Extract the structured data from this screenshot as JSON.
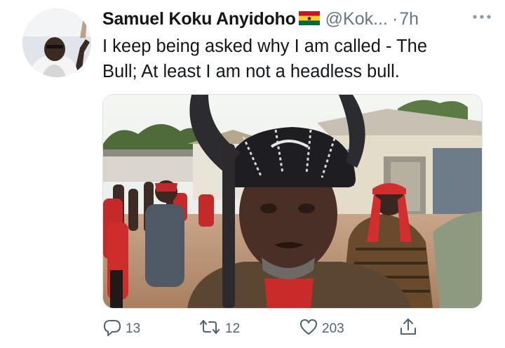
{
  "tweet": {
    "author_name": "Samuel Koku Anyidoho",
    "handle": "@Kok...",
    "separator": "·",
    "timestamp": "7h",
    "text": "I keep being asked why I am called - The\nBull;  At least I am not a headless bull."
  },
  "actions": {
    "reply_count": "13",
    "retweet_count": "12",
    "like_count": "203"
  },
  "icons": {
    "reply": "reply-icon",
    "retweet": "retweet-icon",
    "like": "heart-icon",
    "share": "share-icon",
    "more": "more-icon",
    "flag": "ghana-flag-icon"
  },
  "colors": {
    "text": "#14171a",
    "secondary": "#657786",
    "icon": "#536471",
    "flag_red": "#ce1126",
    "flag_gold": "#fcd116",
    "flag_green": "#006b3f"
  }
}
